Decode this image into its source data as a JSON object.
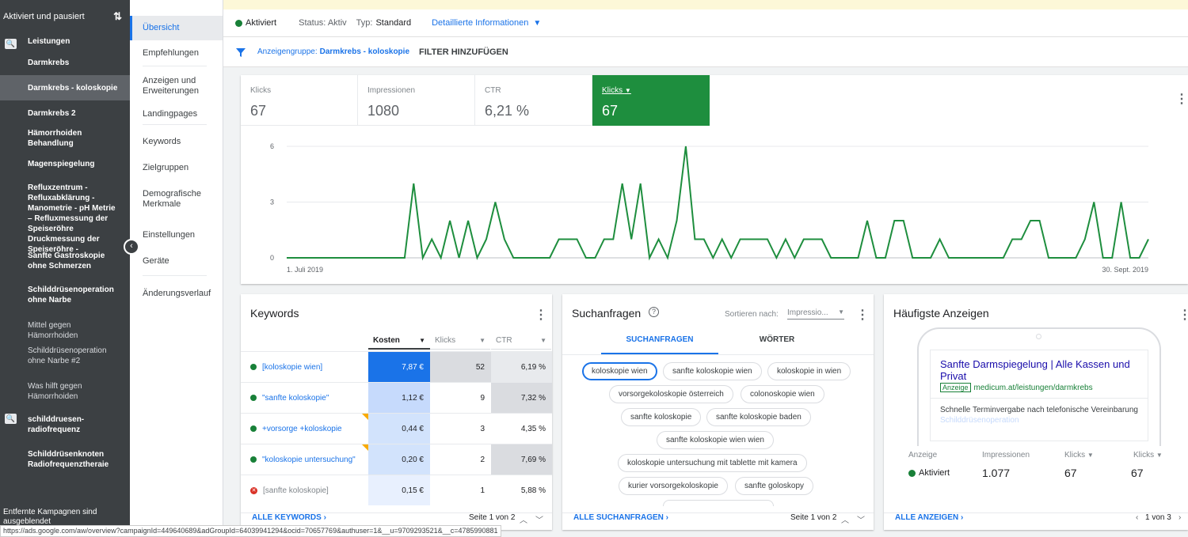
{
  "sidebar": {
    "header": "Aktiviert und pausiert",
    "campaign1": "Leistungen",
    "groups": [
      "Darmkrebs",
      "Darmkrebs - koloskopie",
      "Darmkrebs 2",
      "Hämorrhoiden Behandlung",
      "Magenspiegelung",
      "Refluxzentrum - Refluxabklärung - Manometrie - pH Metrie – Refluxmessung der Speiseröhre Druckmessung der Speiseröhre -",
      "Sanfte Gastroskopie ohne Schmerzen",
      "Schilddrüsenoperation ohne Narbe",
      "Mittel gegen Hämorrhoiden",
      "Schilddrüsenoperation ohne Narbe #2",
      "Was hilft gegen Hämorrhoiden"
    ],
    "campaign2": "schilddruesen-radiofrequenz",
    "group2": "Schilddrüsenknoten Radiofrequenztheraie",
    "footer": "Entfernte Kampagnen sind ausgeblendet"
  },
  "nav": [
    "Übersicht",
    "Empfehlungen",
    "Anzeigen und Erweiterungen",
    "Landingpages",
    "Keywords",
    "Zielgruppen",
    "Demografische Merkmale",
    "Einstellungen",
    "Geräte",
    "Änderungsverlauf"
  ],
  "status": {
    "state": "Aktiviert",
    "status": "Status: Aktiv",
    "type_label": "Typ:",
    "type": "Standard",
    "details": "Detaillierte Informationen"
  },
  "filter": {
    "prefix": "Anzeigengruppe:",
    "value": "Darmkrebs - koloskopie",
    "add": "FILTER HINZUFÜGEN"
  },
  "metrics": [
    {
      "label": "Klicks",
      "value": "67"
    },
    {
      "label": "Impressionen",
      "value": "1080"
    },
    {
      "label": "CTR",
      "value": "6,21 %"
    },
    {
      "label": "Klicks",
      "value": "67"
    }
  ],
  "chart_data": {
    "type": "line",
    "x_start": "1. Juli 2019",
    "x_end": "30. Sept. 2019",
    "ylim": [
      0,
      6
    ],
    "yticks": [
      "6",
      "3",
      "0"
    ],
    "series": [
      {
        "values": [
          0,
          0,
          0,
          0,
          0,
          0,
          0,
          0,
          0,
          0,
          0,
          0,
          0,
          0,
          4,
          0,
          1,
          0,
          2,
          0,
          2,
          0,
          1,
          3,
          1,
          0,
          0,
          0,
          0,
          0,
          1,
          1,
          1,
          0,
          0,
          1,
          1,
          4,
          1,
          4,
          0,
          1,
          0,
          2,
          6,
          1,
          1,
          0,
          1,
          0,
          1,
          1,
          1,
          1,
          0,
          1,
          0,
          1,
          1,
          1,
          0,
          0,
          0,
          0,
          2,
          0,
          0,
          2,
          2,
          0,
          0,
          0,
          1,
          0,
          0,
          0,
          0,
          0,
          0,
          0,
          1,
          1,
          2,
          2,
          0,
          0,
          0,
          0,
          1,
          3,
          0,
          0,
          3,
          0,
          0,
          1
        ]
      }
    ],
    "color": "#1e8e3e"
  },
  "keywords": {
    "title": "Keywords",
    "cols": [
      "Kosten",
      "Klicks",
      "CTR"
    ],
    "rows": [
      {
        "name": "[koloskopie wien]",
        "cost": "7,87 €",
        "clicks": "52",
        "ctr": "6,19 %"
      },
      {
        "name": "\"sanfte koloskopie\"",
        "cost": "1,12 €",
        "clicks": "9",
        "ctr": "7,32 %"
      },
      {
        "name": "+vorsorge +koloskopie",
        "cost": "0,44 €",
        "clicks": "3",
        "ctr": "4,35 %"
      },
      {
        "name": "\"koloskopie untersuchung\"",
        "cost": "0,20 €",
        "clicks": "2",
        "ctr": "7,69 %"
      },
      {
        "name": "[sanfte koloskopie]",
        "cost": "0,15 €",
        "clicks": "1",
        "ctr": "5,88 %"
      }
    ],
    "all": "ALLE KEYWORDS",
    "page": "Seite 1 von 2"
  },
  "queries": {
    "title": "Suchanfragen",
    "sort_label": "Sortieren nach:",
    "sort_value": "Impressio...",
    "tab1": "SUCHANFRAGEN",
    "tab2": "WÖRTER",
    "chips": [
      "koloskopie wien",
      "sanfte koloskopie wien",
      "koloskopie in wien",
      "vorsorgekoloskopie österreich",
      "colonoskopie wien",
      "sanfte koloskopie",
      "sanfte koloskopie baden",
      "sanfte koloskopie wien wien",
      "koloskopie untersuchung mit tablette mit kamera",
      "kurier vorsorgekoloskopie",
      "sanfte goloskopy"
    ],
    "all": "ALLE SUCHANFRAGEN",
    "page": "Seite 1 von 2"
  },
  "ads": {
    "title": "Häufigste Anzeigen",
    "headline": "Sanfte Darmspiegelung | Alle Kassen und Privat",
    "badge": "Anzeige",
    "url": "medicum.at/leistungen/darmkrebs",
    "desc": "Schnelle Terminvergabe nach telefonische Vereinbarung",
    "faded": "Schilddrüsenoperation",
    "stats_labels": [
      "Anzeige",
      "Impressionen",
      "Klicks",
      "Klicks"
    ],
    "stats_values": [
      "Aktiviert",
      "1.077",
      "67",
      "67"
    ],
    "all": "ALLE ANZEIGEN",
    "page": "1 von 3"
  },
  "statusbar": "https://ads.google.com/aw/overview?campaignId=449640689&adGroupId=64039941294&ocid=70657769&authuser=1&__u=9709293521&__c=4785990881"
}
